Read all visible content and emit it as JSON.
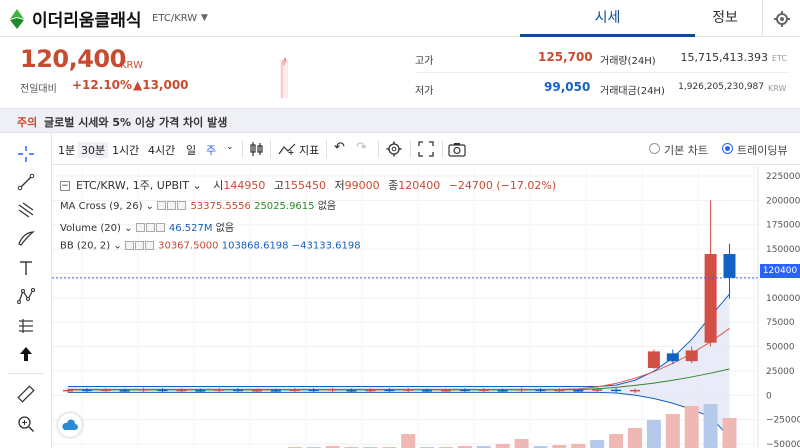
{
  "header": {
    "coin_name": "이더리움클래식",
    "pair": "ETC/KRW",
    "tabs": [
      {
        "label": "시세",
        "active": true
      },
      {
        "label": "정보",
        "active": false
      }
    ],
    "accent_color": "#0b4b93"
  },
  "price": {
    "current": "120,400",
    "unit": "KRW",
    "prev_label": "전일대비",
    "change_pct": "+12.10%",
    "change_amount": "▲13,000",
    "color": "#c84a31"
  },
  "stats": {
    "high_label": "고가",
    "high": "125,700",
    "low_label": "저가",
    "low": "99,050",
    "volume_label": "거래량(24H)",
    "volume": "15,715,413.393",
    "volume_unit": "ETC",
    "amount_label": "거래대금(24H)",
    "amount": "1,926,205,230,987",
    "amount_unit": "KRW",
    "high_color": "#c84a31",
    "low_color": "#1261c4"
  },
  "notice": {
    "tag": "주의",
    "text": "글로벌 시세와 5% 이상 가격 차이 발생"
  },
  "toolbar": {
    "intervals": [
      "1분",
      "30분",
      "1시간",
      "4시간",
      "일",
      "주"
    ],
    "indicator_label": "지표",
    "chart_modes": [
      {
        "label": "기본 차트",
        "selected": false
      },
      {
        "label": "트레이딩뷰",
        "selected": true
      }
    ]
  },
  "legend": {
    "symbol": "ETC/KRW, 1주, UPBIT",
    "ohlc": {
      "open_label": "시",
      "open": "144950",
      "high_label": "고",
      "high": "155450",
      "low_label": "저",
      "low": "99000",
      "close_label": "종",
      "close": "120400",
      "change": "−24700 (−17.02%)"
    },
    "ma": {
      "name": "MA Cross (9, 26)",
      "v1": "53375.5556",
      "v2": "25025.9615",
      "extra": "없음"
    },
    "volume": {
      "name": "Volume (20)",
      "v1": "46.527M",
      "extra": "없음"
    },
    "bb": {
      "name": "BB (20, 2)",
      "v1": "30367.5000",
      "v2": "103868.6198",
      "v3": "−43133.6198"
    }
  },
  "axis": {
    "ticks": [
      "225000",
      "200000",
      "175000",
      "150000",
      "125000",
      "100000",
      "75000",
      "50000",
      "25000",
      "0",
      "−25000",
      "−50000"
    ],
    "last_price_label": "120400"
  },
  "chart_data": {
    "type": "candlestick",
    "ylim": [
      -50000,
      225000
    ],
    "last_price": 120400,
    "up_color": "#d24f45",
    "down_color": "#1261c4",
    "candles_tail": [
      {
        "open": 28000,
        "high": 47000,
        "low": 27000,
        "close": 45000,
        "up": true
      },
      {
        "open": 43000,
        "high": 47000,
        "low": 32000,
        "close": 35000,
        "up": false
      },
      {
        "open": 35000,
        "high": 50000,
        "low": 33000,
        "close": 46000,
        "up": true
      },
      {
        "open": 54000,
        "high": 200000,
        "low": 50000,
        "close": 144950,
        "up": true
      },
      {
        "open": 144950,
        "high": 155450,
        "low": 99000,
        "close": 120400,
        "up": false
      }
    ]
  }
}
